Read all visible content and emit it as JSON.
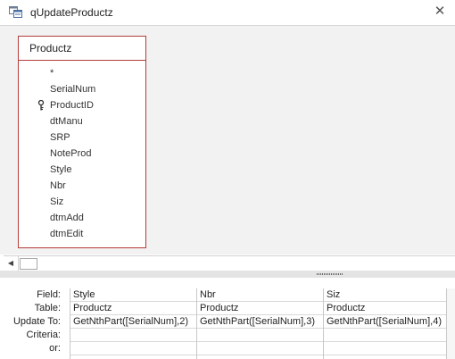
{
  "window": {
    "title": "qUpdateProductz"
  },
  "field_list": {
    "table_name": "Productz",
    "fields": [
      "*",
      "SerialNum",
      "ProductID",
      "dtManu",
      "SRP",
      "NoteProd",
      "Style",
      "Nbr",
      "Siz",
      "dtmAdd",
      "dtmEdit"
    ],
    "primary_key": "ProductID"
  },
  "grid": {
    "row_labels": [
      "Field:",
      "Table:",
      "Update To:",
      "Criteria:",
      "or:"
    ],
    "columns": [
      {
        "field": "Style",
        "table": "Productz",
        "update_to": "GetNthPart([SerialNum],2)",
        "criteria": "",
        "or": ""
      },
      {
        "field": "Nbr",
        "table": "Productz",
        "update_to": "GetNthPart([SerialNum],3)",
        "criteria": "",
        "or": ""
      },
      {
        "field": "Siz",
        "table": "Productz",
        "update_to": "GetNthPart([SerialNum],4)",
        "criteria": "",
        "or": ""
      }
    ]
  },
  "icons": {
    "title": "query-design-icon",
    "key": "primary-key-icon",
    "close": "close-icon"
  },
  "colors": {
    "table_border": "#b43c3c",
    "pane_background": "#f2f2f2"
  }
}
